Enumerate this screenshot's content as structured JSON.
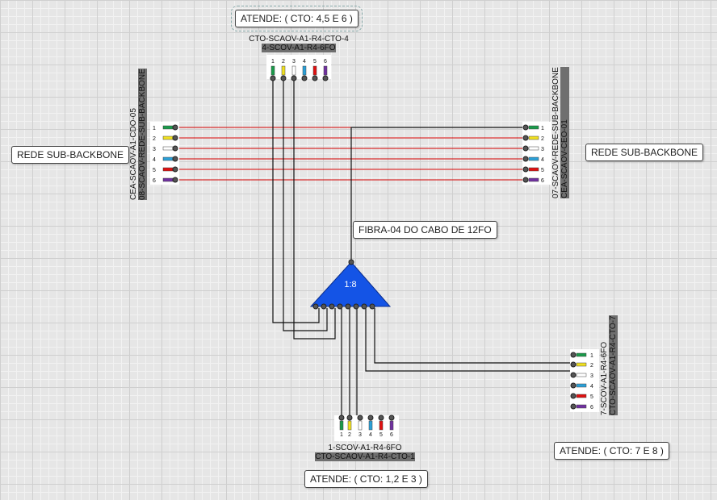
{
  "notes": {
    "top": "ATENDE: ( CTO: 4,5 E 6 )",
    "left": "REDE SUB-BACKBONE",
    "right": "REDE SUB-BACKBONE",
    "fibra": "FIBRA-04 DO CABO DE 12FO",
    "bottom_right": "ATENDE: ( CTO: 7 E 8 )",
    "bottom": "ATENDE: ( CTO: 1,2 E 3 )"
  },
  "splitter": {
    "label": "1:8",
    "color": "#1454e6"
  },
  "cables": {
    "top": {
      "line1": "CTO-SCAOV-A1-R4-CTO-4",
      "line2": "4-SCOV-A1-R4-6FO"
    },
    "bottom": {
      "line1": "1-SCOV-A1-R4-6FO",
      "line2": "CTO-SCAOV-A1-R4-CTO-1"
    },
    "left": {
      "line1": "CEA-SCAOV-A1-CDO-05",
      "line2": "08-SCAOV-REDE-SUB-BACKBONE"
    },
    "right": {
      "line1": "07-SCAOV-REDE-SUB-BACKBONE",
      "line2": "CEA-SCAOV-CEO-01"
    },
    "bottom_right": {
      "line1": "7-SCOV-A1-R4-6FO",
      "line2": "CTO-SCAOV-A1-R4-CTO-7"
    }
  },
  "fibers": {
    "numbers": [
      "1",
      "2",
      "3",
      "4",
      "5",
      "6"
    ],
    "colors": [
      "#1a9a4a",
      "#f0e020",
      "#ffffff",
      "#2aa0d8",
      "#e01010",
      "#7030a0"
    ]
  },
  "link_colors": {
    "fusion": "#d40000",
    "drop": "#111111"
  }
}
